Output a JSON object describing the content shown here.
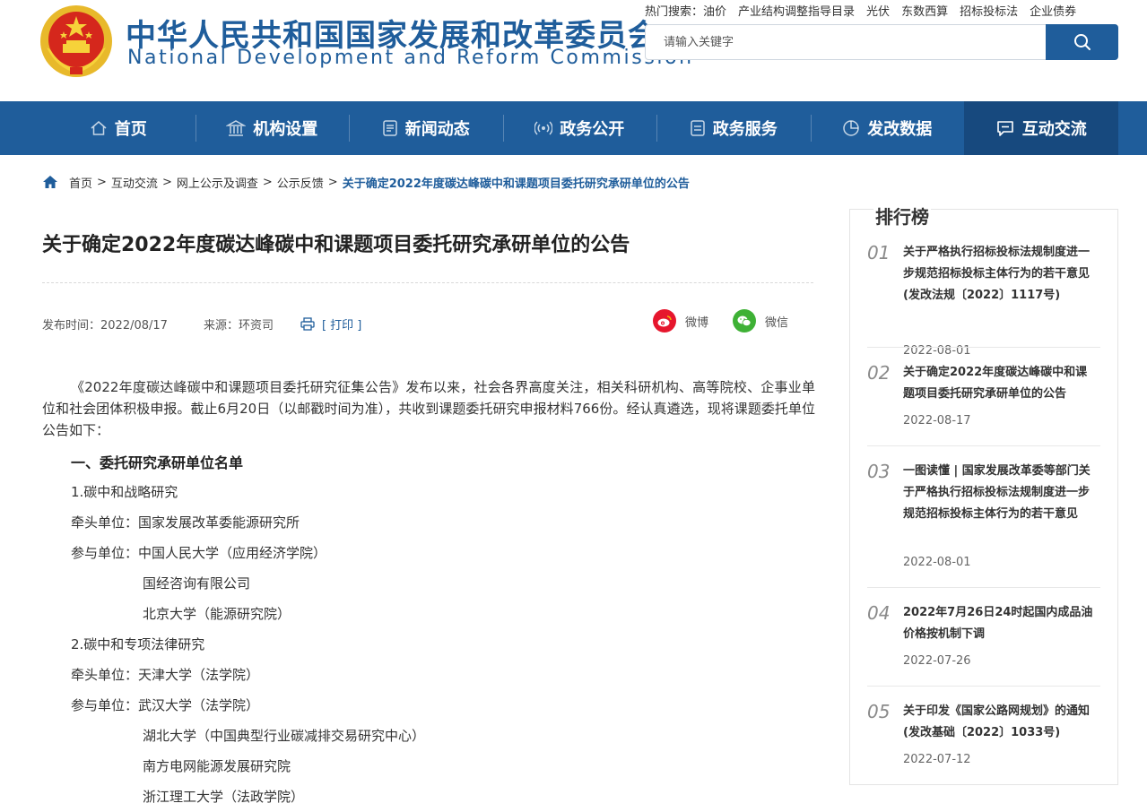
{
  "site": {
    "title_cn": "中华人民共和国国家发展和改革委员会",
    "title_en": "National Development and Reform Commission"
  },
  "hot_search": {
    "label": "热门搜索：",
    "items": [
      "油价",
      "产业结构调整指导目录",
      "光伏",
      "东数西算",
      "招标投标法",
      "企业债券"
    ]
  },
  "search": {
    "placeholder": "请输入关键字"
  },
  "nav": {
    "items": [
      {
        "label": "首页",
        "icon": "home-icon"
      },
      {
        "label": "机构设置",
        "icon": "institution-icon"
      },
      {
        "label": "新闻动态",
        "icon": "news-icon"
      },
      {
        "label": "政务公开",
        "icon": "broadcast-icon"
      },
      {
        "label": "政务服务",
        "icon": "service-icon"
      },
      {
        "label": "发改数据",
        "icon": "pie-chart-icon"
      },
      {
        "label": "互动交流",
        "icon": "chat-icon"
      }
    ],
    "active_index": 6
  },
  "breadcrumb": [
    "首页",
    "互动交流",
    "网上公示及调查",
    "公示反馈",
    "关于确定2022年度碳达峰碳中和课题项目委托研究承研单位的公告"
  ],
  "article": {
    "title": "关于确定2022年度碳达峰碳中和课题项目委托研究承研单位的公告",
    "publish_time": "发布时间：2022/08/17",
    "source": "来源：环资司",
    "print": "[ 打印 ]",
    "share_weibo": "微博",
    "share_wechat": "微信",
    "intro": "《2022年度碳达峰碳中和课题项目委托研究征集公告》发布以来，社会各界高度关注，相关科研机构、高等院校、企事业单位和社会团体积极申报。截止6月20日（以邮戳时间为准），共收到课题委托研究申报材料766份。经认真遴选，现将课题委托单位公告如下：",
    "section1": "一、委托研究承研单位名单",
    "lines": [
      "1.碳中和战略研究",
      "牵头单位：国家发展改革委能源研究所",
      "参与单位：中国人民大学（应用经济学院）",
      "国经咨询有限公司",
      "北京大学（能源研究院）",
      "2.碳中和专项法律研究",
      "牵头单位：天津大学（法学院）",
      "参与单位：武汉大学（法学院）",
      "湖北大学（中国典型行业碳减排交易研究中心）",
      "南方电网能源发展研究院",
      "浙江理工大学（法政学院）"
    ]
  },
  "rank": {
    "title": "排行榜",
    "items": [
      {
        "num": "01",
        "text": "关于严格执行招标投标法规制度进一步规范招标投标主体行为的若干意见(发改法规〔2022〕1117号)",
        "date": "2022-08-01"
      },
      {
        "num": "02",
        "text": "关于确定2022年度碳达峰碳中和课题项目委托研究承研单位的公告",
        "date": "2022-08-17"
      },
      {
        "num": "03",
        "text": "一图读懂 | 国家发展改革委等部门关于严格执行招标投标法规制度进一步规范招标投标主体行为的若干意见",
        "date": "2022-08-01"
      },
      {
        "num": "04",
        "text": "2022年7月26日24时起国内成品油价格按机制下调",
        "date": "2022-07-26"
      },
      {
        "num": "05",
        "text": "关于印发《国家公路网规划》的通知(发改基础〔2022〕1033号)",
        "date": "2022-07-12"
      }
    ]
  },
  "colors": {
    "brand": "#1f5d9b",
    "nav_active": "#17497e",
    "weibo": "#e6162d",
    "wechat": "#3eb135"
  }
}
